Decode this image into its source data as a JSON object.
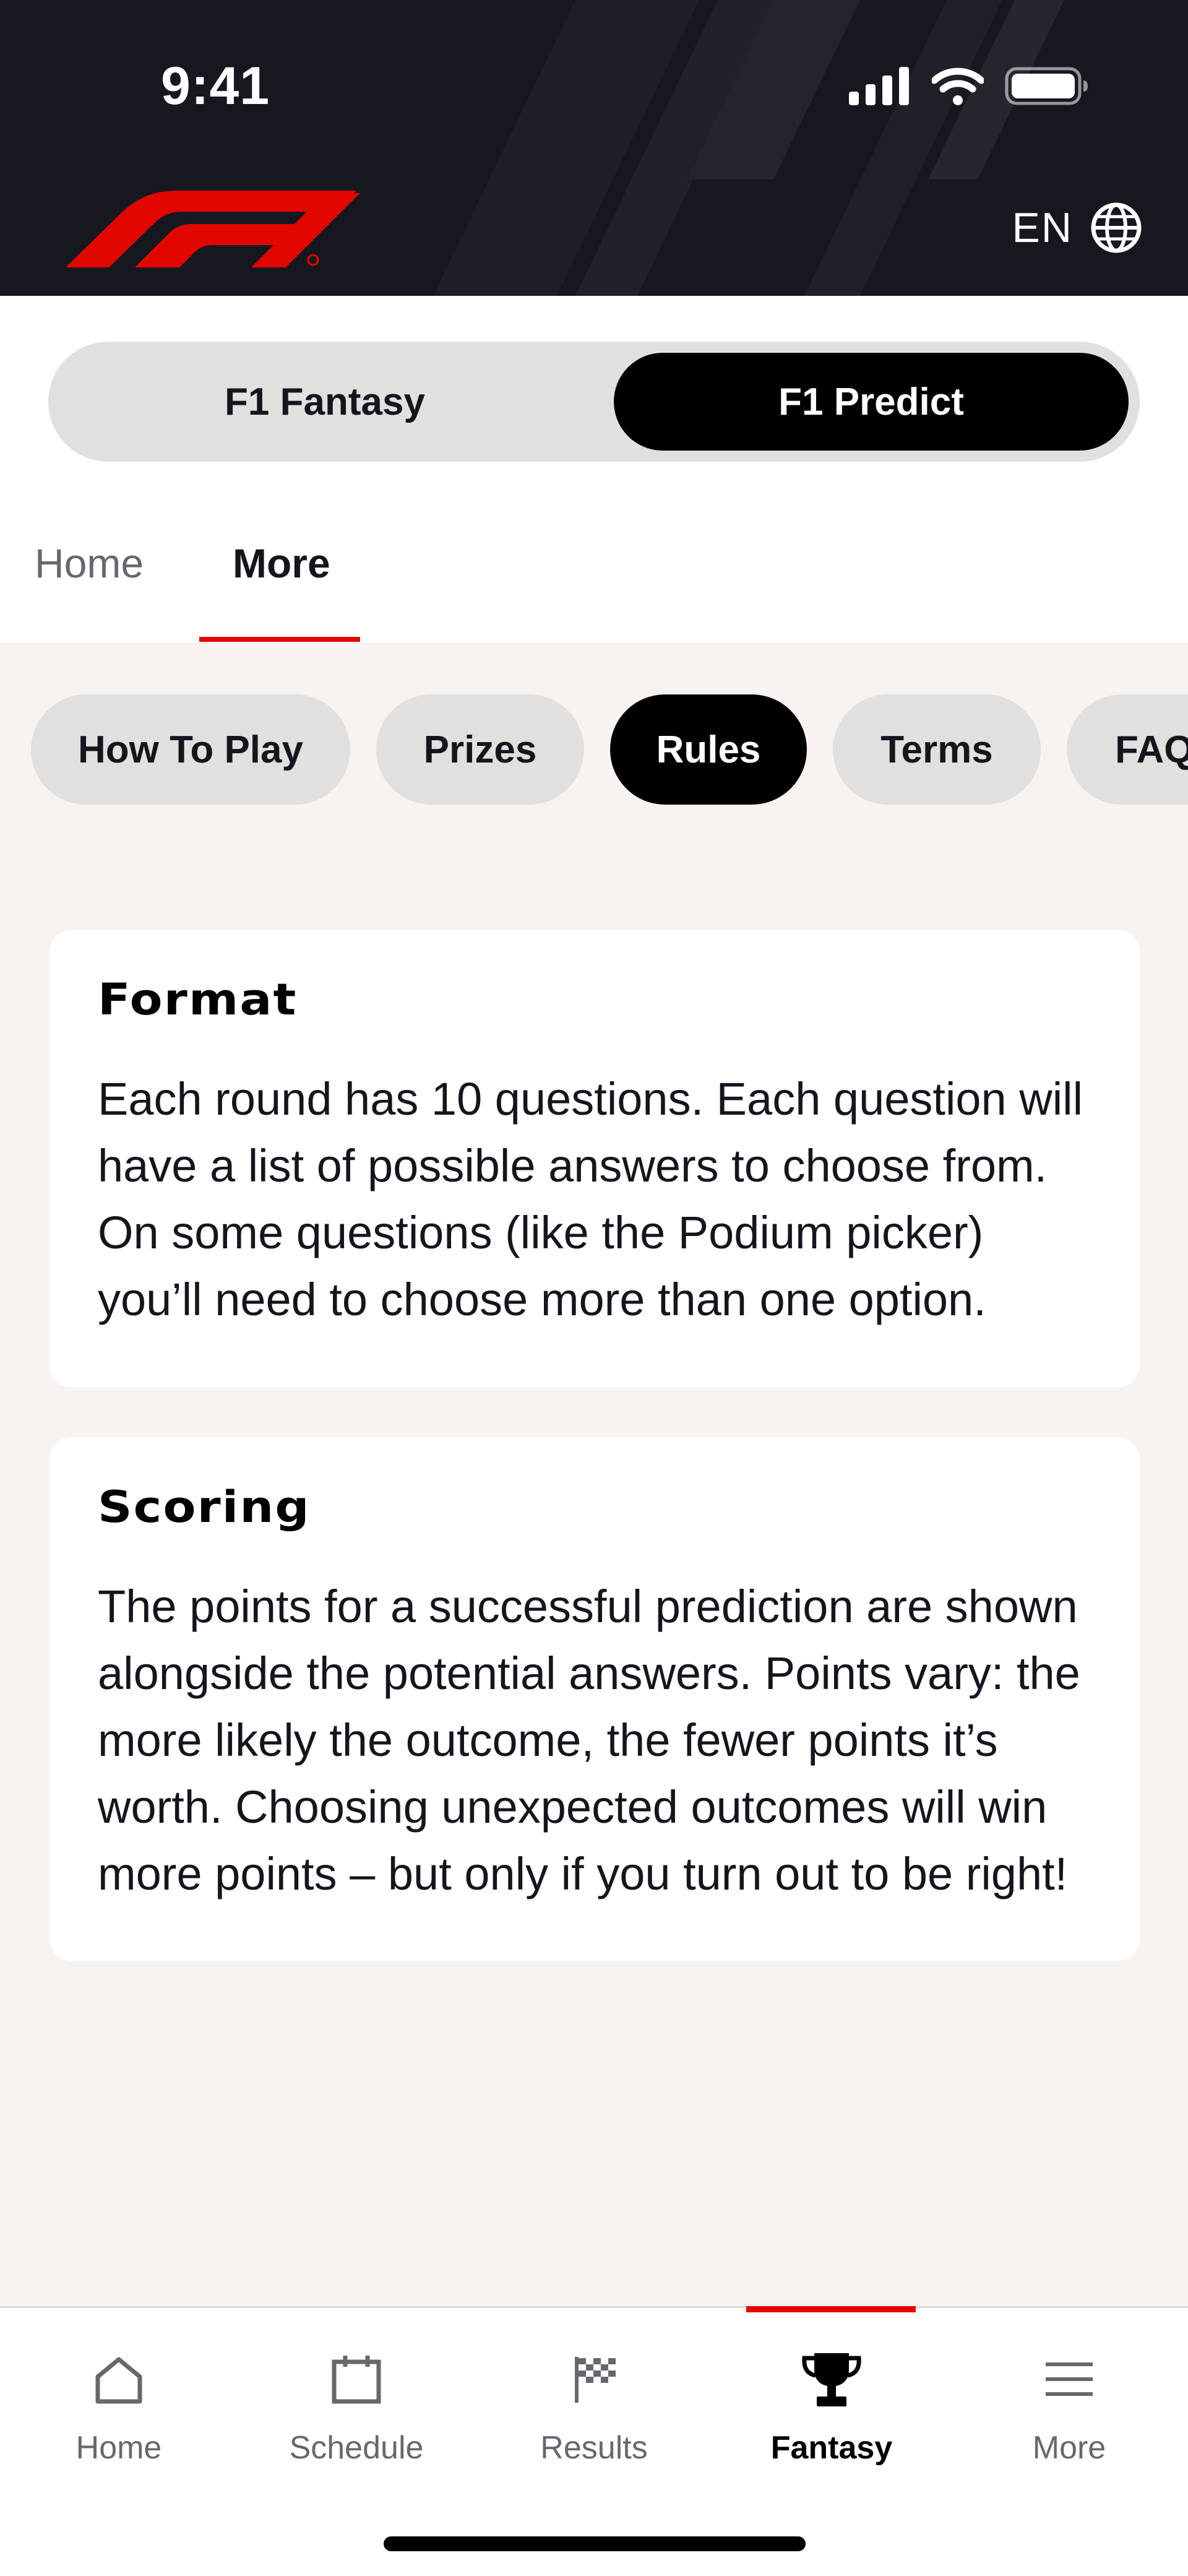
{
  "status_bar": {
    "time": "9:41"
  },
  "header": {
    "language": "EN"
  },
  "segmented_control": {
    "options": [
      "F1 Fantasy",
      "F1 Predict"
    ],
    "selected": "F1 Predict"
  },
  "subnav": {
    "items": [
      "Home",
      "More"
    ],
    "active": "More"
  },
  "chips": {
    "items": [
      "How To Play",
      "Prizes",
      "Rules",
      "Terms",
      "FAQ"
    ],
    "active": "Rules"
  },
  "cards": [
    {
      "title": "Format",
      "body": "Each round has 10 questions. Each question will have a list of possible answers to choose from. On some questions (like the Podium picker) you’ll need to choose more than one option."
    },
    {
      "title": "Scoring",
      "body": "The points for a successful prediction are shown alongside the potential answers. Points vary: the more likely the outcome, the fewer points it’s worth. Choosing unexpected outcomes will win more points – but only if you turn out to be right!"
    }
  ],
  "bottom_nav": {
    "items": [
      {
        "label": "Home",
        "icon": "house-icon"
      },
      {
        "label": "Schedule",
        "icon": "calendar-icon"
      },
      {
        "label": "Results",
        "icon": "checkered-flag-icon"
      },
      {
        "label": "Fantasy",
        "icon": "trophy-icon"
      },
      {
        "label": "More",
        "icon": "menu-icon"
      }
    ],
    "active": "Fantasy"
  },
  "colors": {
    "brand_red": "#e10600",
    "header_bg": "#16171f",
    "page_bg": "#f6f3f0"
  }
}
